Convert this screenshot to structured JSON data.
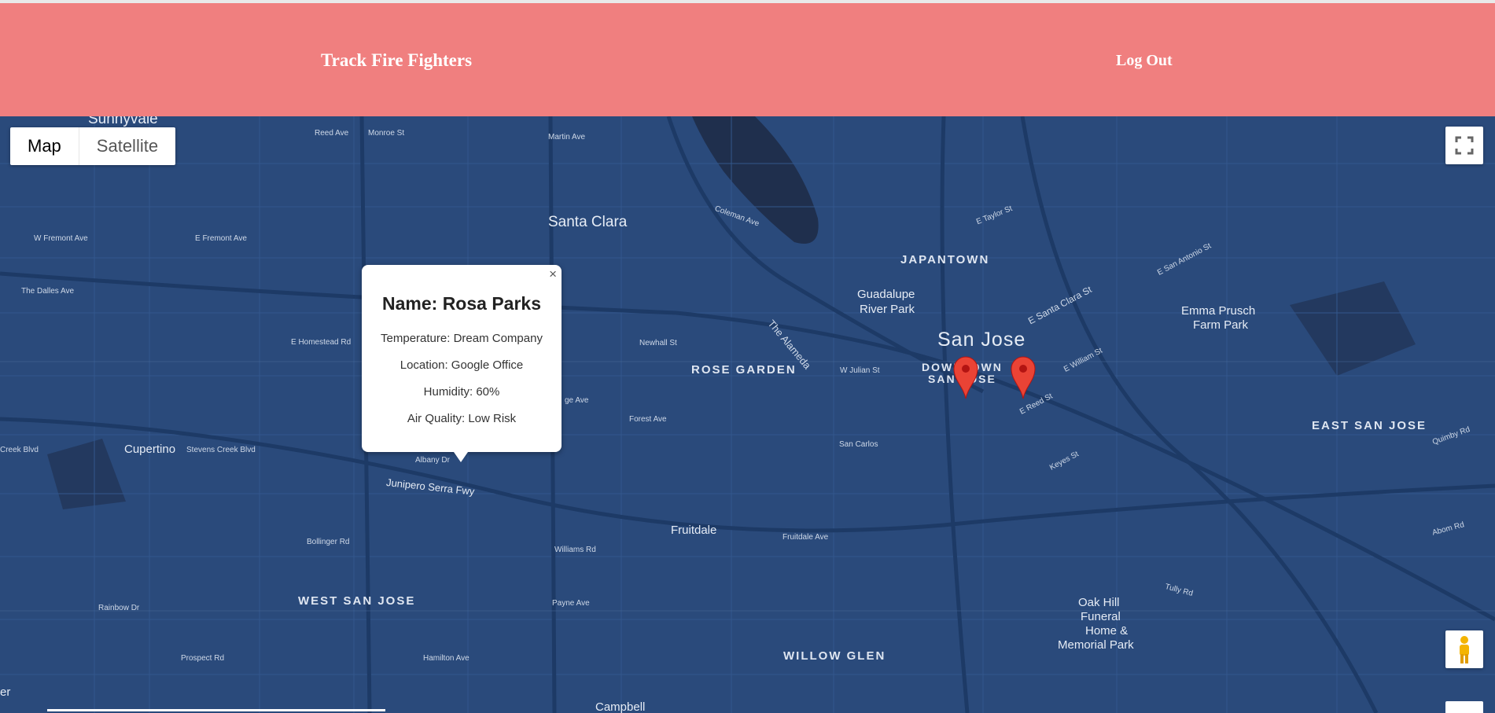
{
  "header": {
    "brand": "Track Fire Fighters",
    "logout": "Log Out"
  },
  "colors": {
    "header": "#f07f7f",
    "map": "#2a4a7b",
    "marker": "#ea4335"
  },
  "map_controls": {
    "map": "Map",
    "satellite": "Satellite",
    "fullscreen_icon": "fullscreen-icon",
    "pegman_icon": "pegman-icon"
  },
  "infowindow": {
    "name": "Name: Rosa Parks",
    "temperature": "Temperature: Dream Company",
    "location": "Location: Google Office",
    "humidity": "Humidity: 60%",
    "air": "Air Quality: Low Risk",
    "close": "×"
  },
  "labels": {
    "sunnyvale": "Sunnyvale",
    "santa_clara": "Santa Clara",
    "japantown": "JAPANTOWN",
    "guadalupe": "Guadalupe",
    "river_park": "River Park",
    "san_jose": "San Jose",
    "downtown": "DOWNTOWN",
    "sanjose_small": "SAN JOSE",
    "rose_garden": "ROSE GARDEN",
    "emma1": "Emma Prusch",
    "emma2": "Farm Park",
    "east_san_jose": "EAST SAN JOSE",
    "cupertino": "Cupertino",
    "fruitdale": "Fruitdale",
    "west_san_jose": "WEST SAN JOSE",
    "willow_glen": "WILLOW GLEN",
    "campbell": "Campbell",
    "oak1": "Oak Hill",
    "oak2": "Funeral",
    "oak3": "Home &",
    "oak4": "Memorial Park",
    "reed_ave": "Reed Ave",
    "monroe_st": "Monroe St",
    "martin_ave": "Martin Ave",
    "w_fremont": "W Fremont Ave",
    "e_fremont": "E Fremont Ave",
    "dalles": "The Dalles Ave",
    "homestead": "E Homestead Rd",
    "creek_blvd": "Creek Blvd",
    "stevens_creek": "Stevens Creek Blvd",
    "albany": "Albany Dr",
    "junipero": "Junipero Serra Fwy",
    "bollinger": "Bollinger Rd",
    "williams": "Williams Rd",
    "payne": "Payne Ave",
    "rainbow": "Rainbow Dr",
    "prospect": "Prospect Rd",
    "hamilton": "Hamilton Ave",
    "newhall": "Newhall St",
    "forest": "Forest Ave",
    "san_carlos": "San Carlos",
    "fruitdale_ave": "Fruitdale Ave",
    "w_julian": "W Julian St",
    "alameda": "The Alameda",
    "coleman": "Coleman Ave",
    "e_taylor": "E Taylor St",
    "e_santa_clara": "E Santa Clara St",
    "e_william": "E William St",
    "e_reed": "E Reed St",
    "keyes": "Keyes St",
    "tully": "Tully Rd",
    "abom": "Abom Rd",
    "quimby": "Quimby Rd",
    "e_san_antonio": "E San Antonio St",
    "ge_ave": "ge Ave",
    "er": "er"
  }
}
